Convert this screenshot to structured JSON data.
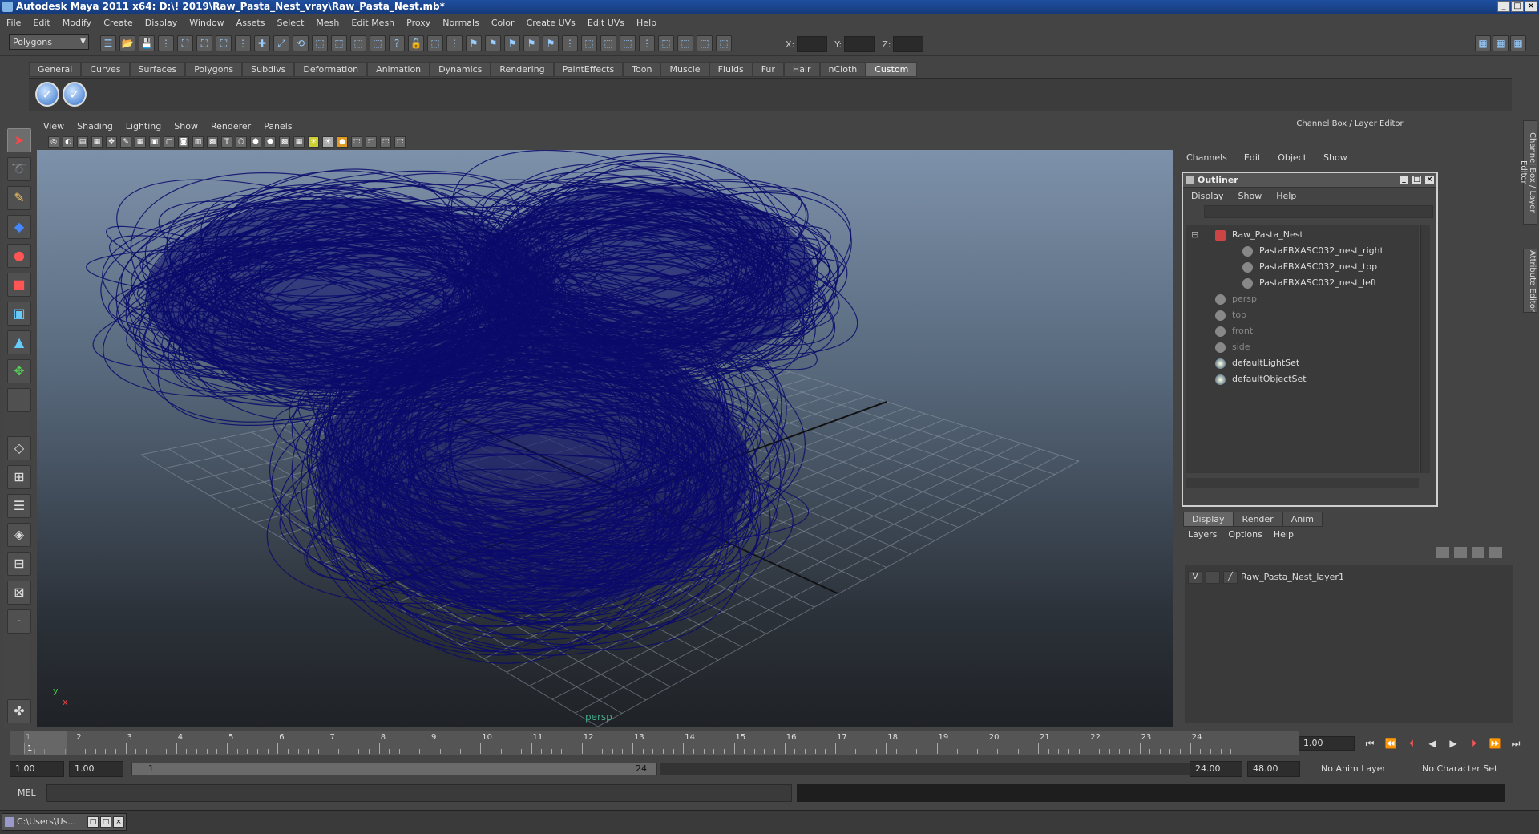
{
  "window": {
    "title": "Autodesk Maya 2011 x64: D:\\! 2019\\Raw_Pasta_Nest_vray\\Raw_Pasta_Nest.mb*",
    "minimize": "_",
    "maximize": "□",
    "close": "×"
  },
  "menubar": [
    "File",
    "Edit",
    "Modify",
    "Create",
    "Display",
    "Window",
    "Assets",
    "Select",
    "Mesh",
    "Edit Mesh",
    "Proxy",
    "Normals",
    "Color",
    "Create UVs",
    "Edit UVs",
    "Help"
  ],
  "statusline": {
    "mode": "Polygons",
    "x_label": "X:",
    "y_label": "Y:",
    "z_label": "Z:"
  },
  "shelf": {
    "tabs": [
      "General",
      "Curves",
      "Surfaces",
      "Polygons",
      "Subdivs",
      "Deformation",
      "Animation",
      "Dynamics",
      "Rendering",
      "PaintEffects",
      "Toon",
      "Muscle",
      "Fluids",
      "Fur",
      "Hair",
      "nCloth",
      "Custom"
    ],
    "active_tab": "Custom"
  },
  "viewport": {
    "menu": [
      "View",
      "Shading",
      "Lighting",
      "Show",
      "Renderer",
      "Panels"
    ],
    "camera": "persp",
    "axis_x": "x",
    "axis_y": "y",
    "wire_color": "#0b0b6b"
  },
  "channelbox": {
    "title": "Channel Box / Layer Editor",
    "menu": [
      "Channels",
      "Edit",
      "Object",
      "Show"
    ]
  },
  "outliner": {
    "title": "Outliner",
    "menu": [
      "Display",
      "Show",
      "Help"
    ],
    "items": [
      {
        "label": "Raw_Pasta_Nest",
        "dim": false
      },
      {
        "label": "PastaFBXASC032_nest_right",
        "dim": false
      },
      {
        "label": "PastaFBXASC032_nest_top",
        "dim": false
      },
      {
        "label": "PastaFBXASC032_nest_left",
        "dim": false
      },
      {
        "label": "persp",
        "dim": true
      },
      {
        "label": "top",
        "dim": true
      },
      {
        "label": "front",
        "dim": true
      },
      {
        "label": "side",
        "dim": true
      },
      {
        "label": "defaultLightSet",
        "dim": false
      },
      {
        "label": "defaultObjectSet",
        "dim": false
      }
    ]
  },
  "layers": {
    "tabs": [
      "Display",
      "Render",
      "Anim"
    ],
    "active_tab": "Display",
    "menu": [
      "Layers",
      "Options",
      "Help"
    ],
    "rows": [
      {
        "visible": "V",
        "name": "Raw_Pasta_Nest_layer1"
      }
    ]
  },
  "sidetabs": [
    "Channel Box / Layer Editor",
    "Attribute Editor"
  ],
  "timeline": {
    "ticks": [
      "1",
      "2",
      "3",
      "4",
      "5",
      "6",
      "7",
      "8",
      "9",
      "10",
      "11",
      "12",
      "13",
      "14",
      "15",
      "16",
      "17",
      "18",
      "19",
      "20",
      "21",
      "22",
      "23",
      "24"
    ],
    "current_marker": "1",
    "current_frame": "1.00"
  },
  "range": {
    "start": "1.00",
    "playback_start": "1.00",
    "slider_start": "1",
    "slider_end": "24",
    "playback_end": "24.00",
    "end": "48.00",
    "anim_layer": "No Anim Layer",
    "character_set": "No Character Set"
  },
  "command": {
    "label": "MEL"
  },
  "taskbar": {
    "item": "C:\\Users\\Us..."
  }
}
